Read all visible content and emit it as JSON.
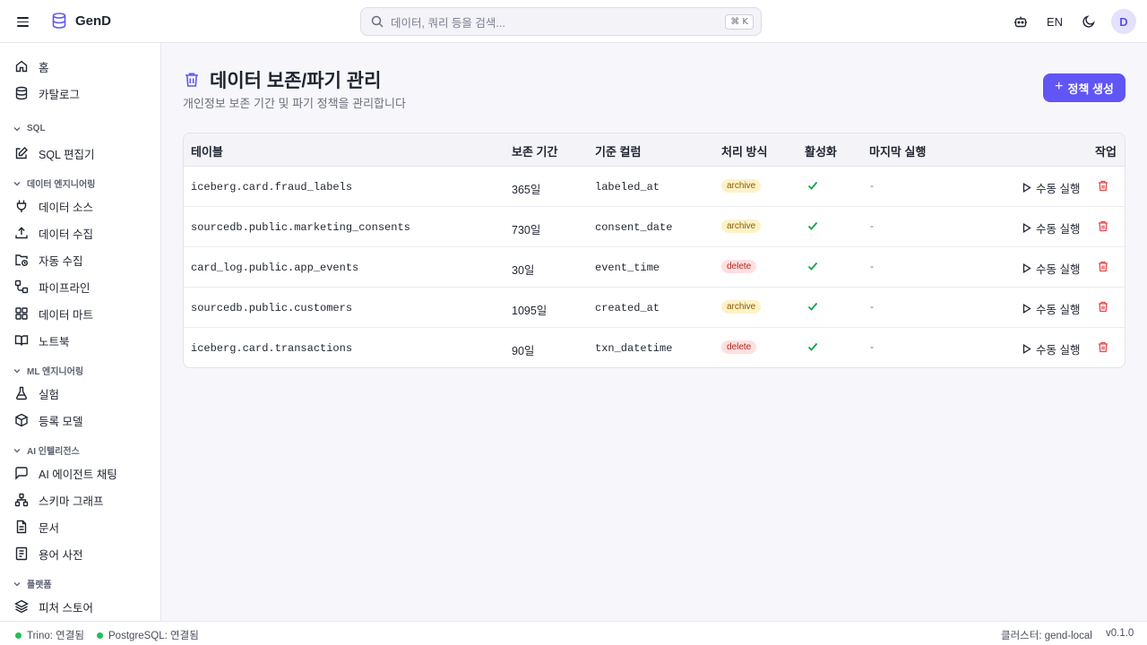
{
  "app": {
    "name": "GenD"
  },
  "search": {
    "placeholder": "데이터, 쿼리 등을 검색...",
    "shortcut": "⌘ K"
  },
  "header": {
    "language": "EN",
    "avatar_initial": "D"
  },
  "sidebar": {
    "home": "홈",
    "catalog": "카탈로그",
    "sections": {
      "sql": "SQL",
      "data_engineering": "데이터 엔지니어링",
      "ml_engineering": "ML 엔지니어링",
      "ai_intelligence": "AI 인텔리전스",
      "platform": "플랫폼"
    },
    "sql_editor": "SQL 편집기",
    "data_sources": "데이터 소스",
    "data_ingestion": "데이터 수집",
    "auto_ingestion": "자동 수집",
    "pipelines": "파이프라인",
    "data_mart": "데이터 마트",
    "notebooks": "노트북",
    "experiments": "실험",
    "registered_models": "등록 모델",
    "ai_agent_chat": "AI 에이전트 채팅",
    "schema_graph": "스키마 그래프",
    "documents": "문서",
    "glossary": "용어 사전",
    "feature_store": "피처 스토어"
  },
  "page": {
    "title": "데이터 보존/파기 관리",
    "subtitle": "개인정보 보존 기간 및 파기 정책을 관리합니다",
    "create_button": "정책 생성"
  },
  "table": {
    "columns": {
      "table": "테이블",
      "retention": "보존 기간",
      "basis_column": "기준 컬럼",
      "method": "처리 방식",
      "active": "활성화",
      "last_run": "마지막 실행",
      "actions": "작업"
    },
    "rows": [
      {
        "table": "iceberg.card.fraud_labels",
        "retention": "365일",
        "basis_column": "labeled_at",
        "method": "archive",
        "active": true,
        "last_run": "-",
        "run_label": "수동 실행"
      },
      {
        "table": "sourcedb.public.marketing_consents",
        "retention": "730일",
        "basis_column": "consent_date",
        "method": "archive",
        "active": true,
        "last_run": "-",
        "run_label": "수동 실행"
      },
      {
        "table": "card_log.public.app_events",
        "retention": "30일",
        "basis_column": "event_time",
        "method": "delete",
        "active": true,
        "last_run": "-",
        "run_label": "수동 실행"
      },
      {
        "table": "sourcedb.public.customers",
        "retention": "1095일",
        "basis_column": "created_at",
        "method": "archive",
        "active": true,
        "last_run": "-",
        "run_label": "수동 실행"
      },
      {
        "table": "iceberg.card.transactions",
        "retention": "90일",
        "basis_column": "txn_datetime",
        "method": "delete",
        "active": true,
        "last_run": "-",
        "run_label": "수동 실행"
      }
    ]
  },
  "footer": {
    "trino_status": "Trino: 연결됨",
    "postgres_status": "PostgreSQL: 연결됨",
    "cluster": "클러스터: gend-local",
    "version": "v0.1.0"
  },
  "colors": {
    "accent": "#6155f5",
    "status_ok": "#1fc05a",
    "check": "#16a34a",
    "danger": "#e5484d"
  }
}
